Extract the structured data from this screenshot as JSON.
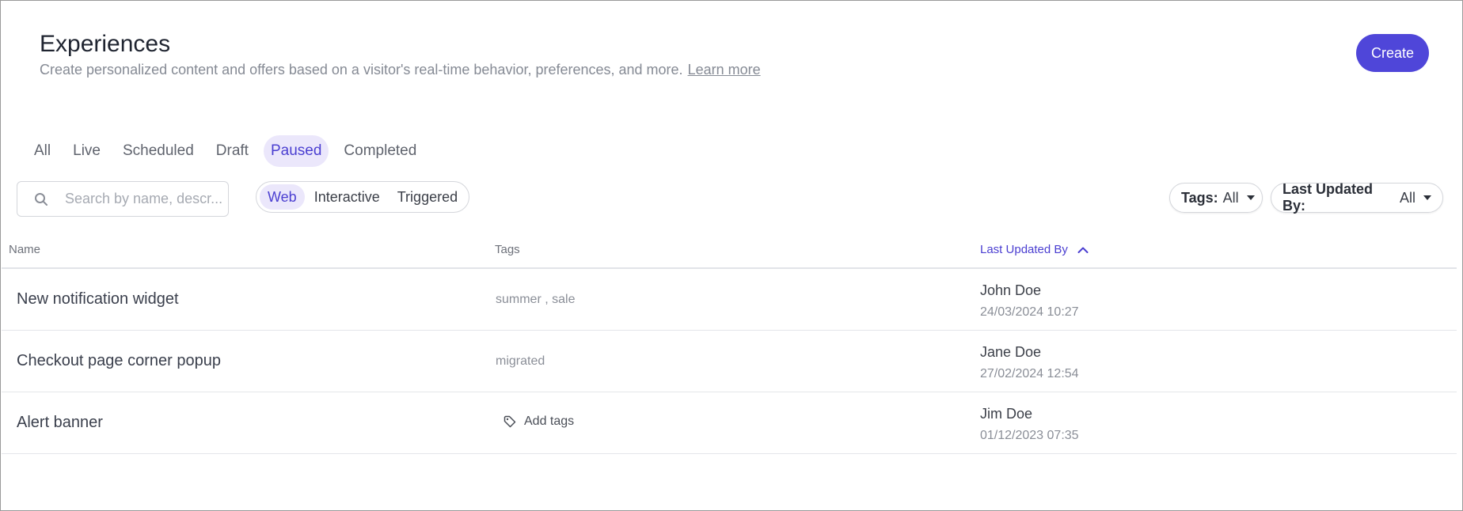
{
  "header": {
    "title": "Experiences",
    "subtitle": "Create personalized content and offers based on a visitor's real-time behavior, preferences, and more.",
    "learn_more": "Learn more",
    "create_label": "Create"
  },
  "status_tabs": [
    {
      "label": "All",
      "active": false
    },
    {
      "label": "Live",
      "active": false
    },
    {
      "label": "Scheduled",
      "active": false
    },
    {
      "label": "Draft",
      "active": false
    },
    {
      "label": "Paused",
      "active": true
    },
    {
      "label": "Completed",
      "active": false
    }
  ],
  "search": {
    "placeholder": "Search by name, descr...",
    "value": "",
    "icon": "search-icon"
  },
  "type_filter": [
    {
      "label": "Web",
      "active": true
    },
    {
      "label": "Interactive",
      "active": false
    },
    {
      "label": "Triggered",
      "active": false
    }
  ],
  "filters": {
    "tags": {
      "label": "Tags:",
      "value": "All"
    },
    "updated": {
      "label": "Last Updated By:",
      "value": "All"
    }
  },
  "table": {
    "columns": {
      "name": "Name",
      "tags": "Tags",
      "updated": "Last Updated By"
    },
    "sort": {
      "column": "updated",
      "direction": "asc",
      "icon": "chevron-up-icon"
    },
    "rows": [
      {
        "name": "New notification widget",
        "tags": "summer , sale",
        "user": "John Doe",
        "date": "24/03/2024 10:27"
      },
      {
        "name": "Checkout page corner popup",
        "tags": "migrated",
        "user": "Jane Doe",
        "date": "27/02/2024 12:54"
      },
      {
        "name": "Alert banner",
        "tags": "",
        "add_tags": "Add tags",
        "user": "Jim Doe",
        "date": "01/12/2023 07:35"
      }
    ]
  },
  "colors": {
    "accent": "#4f46d9",
    "accent_light": "#ebe7fb",
    "muted_text": "#858a94"
  }
}
